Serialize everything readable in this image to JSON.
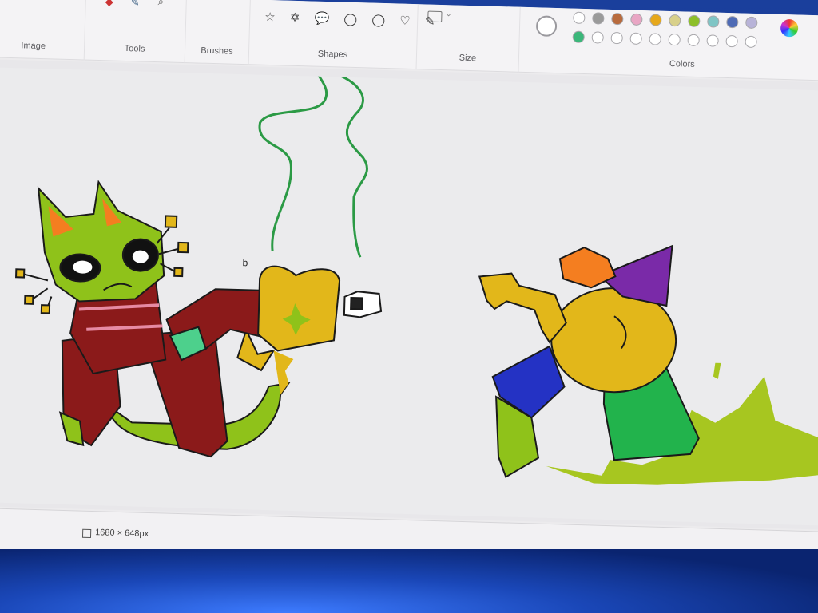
{
  "ribbon": {
    "groups": [
      {
        "id": "image",
        "label": "Image"
      },
      {
        "id": "tools",
        "label": "Tools"
      },
      {
        "id": "brushes",
        "label": "Brushes"
      },
      {
        "id": "shapes",
        "label": "Shapes"
      },
      {
        "id": "size",
        "label": "Size"
      },
      {
        "id": "colors",
        "label": "Colors"
      }
    ],
    "shapes_glyphs": "☆ ✡ 💬 ◯ ◯ ♡ ✎",
    "palette_row1": [
      "#ffffff",
      "#9a9a9a",
      "#b86b3d",
      "#e9a6c4",
      "#e6a81b",
      "#d8d08a",
      "#8dbf2a",
      "#7fc5c5",
      "#4f6bb5",
      "#b8b3d8"
    ],
    "palette_row2": [
      "#3bb77a",
      "#ffffff",
      "#ffffff",
      "#ffffff",
      "#ffffff",
      "#ffffff",
      "#ffffff",
      "#ffffff",
      "#ffffff",
      "#ffffff"
    ]
  },
  "status": {
    "canvas_dimensions": "1680 × 648px"
  },
  "colors": {
    "green_body": "#8fc21a",
    "mint": "#4dd08c",
    "dark_red": "#8b1a1a",
    "pink": "#e68aa3",
    "yellow": "#e2b71a",
    "orange": "#f47e20",
    "purple": "#7a2aa8",
    "blue": "#2432c4",
    "bright_green": "#22b34c",
    "lime_splash": "#a7c620",
    "smoke_green": "#2b9a45"
  }
}
